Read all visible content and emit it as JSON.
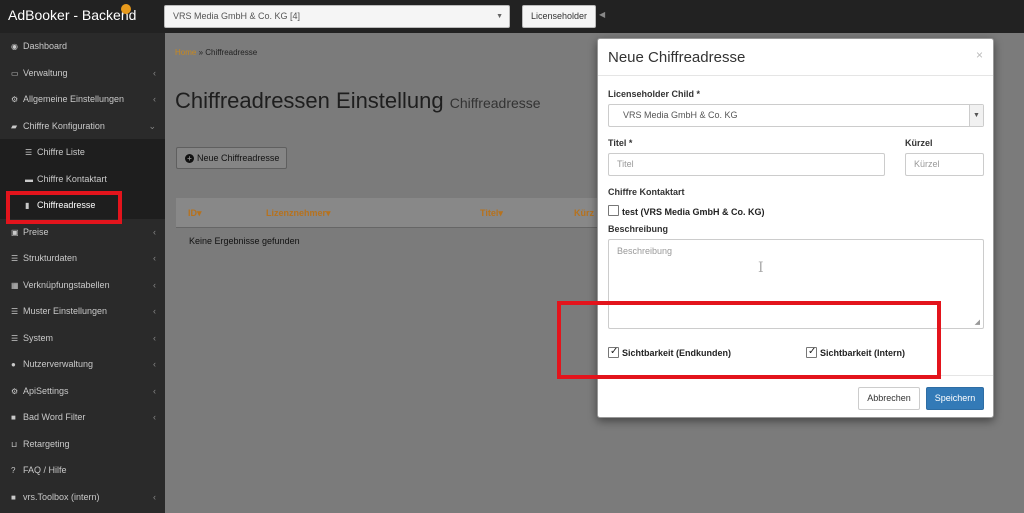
{
  "app": {
    "brand": "AdBooker - Backend"
  },
  "topbar": {
    "tenant_value": "VRS Media GmbH & Co. KG [4]",
    "licenseholder_button": "Licenseholder"
  },
  "sidebar": {
    "items": [
      {
        "label": "Dashboard",
        "icon": "dashboard-icon"
      },
      {
        "label": "Verwaltung",
        "icon": "monitor-icon"
      },
      {
        "label": "Allgemeine Einstellungen",
        "icon": "cogs-icon"
      },
      {
        "label": "Chiffre Konfiguration",
        "icon": "folder-icon"
      },
      {
        "label": "Chiffre Liste",
        "icon": "list-icon"
      },
      {
        "label": "Chiffre Kontaktart",
        "icon": "inbox-icon"
      },
      {
        "label": "Chiffreadresse",
        "icon": "document-icon"
      },
      {
        "label": "Preise",
        "icon": "money-icon"
      },
      {
        "label": "Strukturdaten",
        "icon": "list-icon"
      },
      {
        "label": "Verknüpfungstabellen",
        "icon": "table-icon"
      },
      {
        "label": "Muster Einstellungen",
        "icon": "list-icon"
      },
      {
        "label": "System",
        "icon": "list-icon"
      },
      {
        "label": "Nutzerverwaltung",
        "icon": "user-icon"
      },
      {
        "label": "ApiSettings",
        "icon": "cogs-icon"
      },
      {
        "label": "Bad Word Filter",
        "icon": "lock-icon"
      },
      {
        "label": "Retargeting",
        "icon": "cart-icon"
      },
      {
        "label": "FAQ / Hilfe",
        "icon": "question-icon"
      },
      {
        "label": "vrs.Toolbox (intern)",
        "icon": "lock-icon"
      }
    ]
  },
  "main": {
    "breadcrumb_home": "Home",
    "breadcrumb_sep": "»",
    "breadcrumb_current": "Chiffreadresse",
    "title": "Chiffreadressen Einstellung",
    "subtitle": "Chiffreadresse",
    "new_button": "Neue Chiffreadresse",
    "columns": [
      "ID",
      "Lizenznehmer",
      "Titel",
      "Kürz"
    ],
    "sort_glyph": "▾",
    "empty": "Keine Ergebnisse gefunden"
  },
  "modal": {
    "title": "Neue Chiffreadresse",
    "close": "×",
    "licenseholder_label": "Licenseholder Child *",
    "licenseholder_value": "VRS Media GmbH & Co. KG",
    "titel_label": "Titel *",
    "titel_placeholder": "Titel",
    "kuerzel_label": "Kürzel",
    "kuerzel_placeholder": "Kürzel",
    "kontaktart_label": "Chiffre Kontaktart",
    "kontaktart_option": "test (VRS Media GmbH & Co. KG)",
    "kontaktart_checked": false,
    "beschreibung_label": "Beschreibung",
    "beschreibung_placeholder": "Beschreibung",
    "sicht_endkunden_label": "Sichtbarkeit (Endkunden)",
    "sicht_endkunden_checked": true,
    "sicht_intern_label": "Sichtbarkeit (Intern)",
    "sicht_intern_checked": true,
    "cancel_button": "Abbrechen",
    "save_button": "Speichern"
  },
  "colors": {
    "accent": "#e89a1c",
    "primary": "#337ab7",
    "highlight": "#e3141c",
    "sidebar": "#2a2a2a"
  }
}
